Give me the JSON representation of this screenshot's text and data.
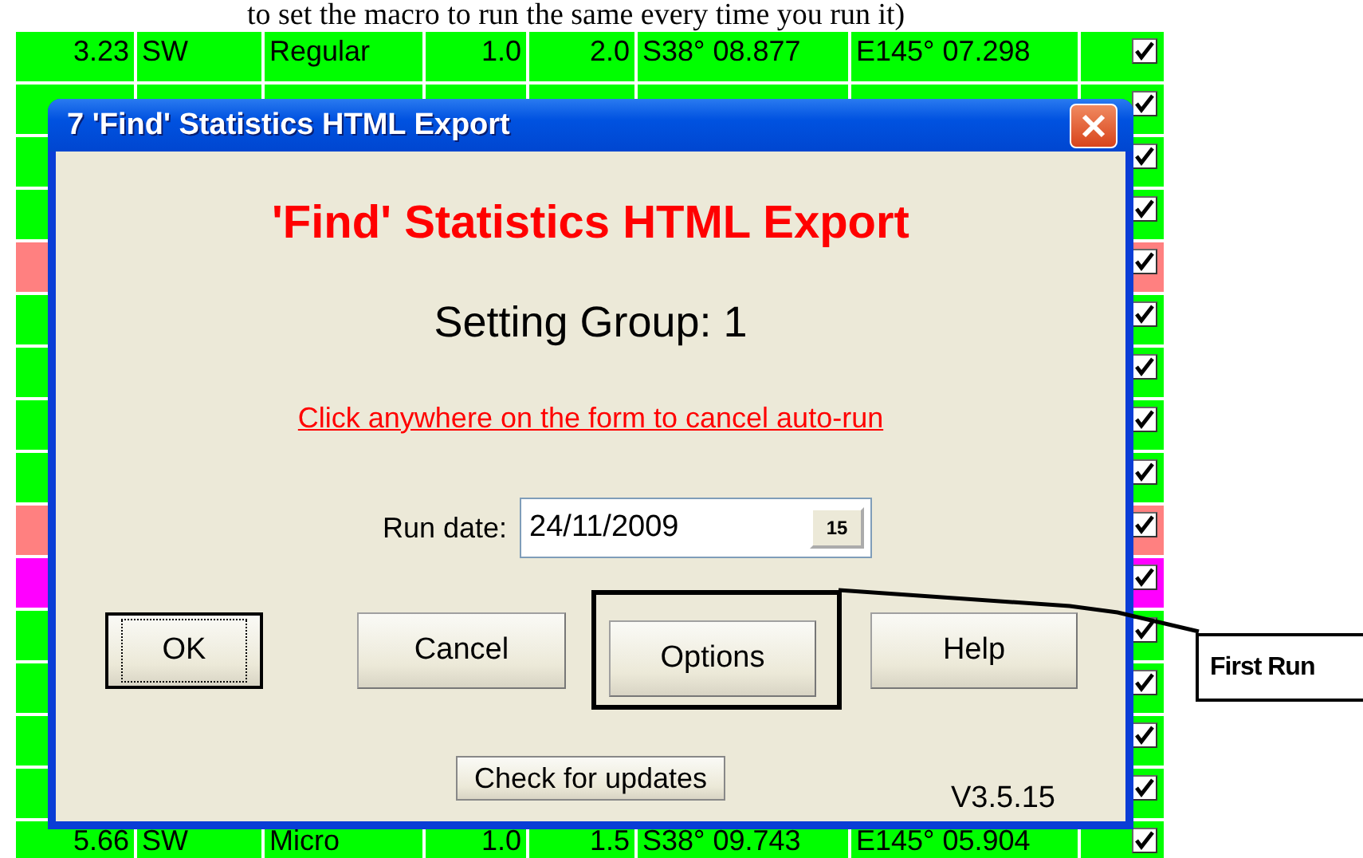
{
  "caption": "to set the macro to run the same every time you run it)",
  "table": {
    "rows": [
      {
        "cells": [
          "3.23",
          "SW",
          "Regular",
          "1.0",
          "2.0",
          "S38° 08.877",
          "E145° 07.298"
        ],
        "checked": true,
        "color": "#00ff00"
      },
      {
        "checked": true,
        "color": "#00ff00"
      },
      {
        "checked": true,
        "color": "#00ff00"
      },
      {
        "checked": true,
        "color": "#00ff00"
      },
      {
        "checked": true,
        "color": "#ff8080"
      },
      {
        "checked": true,
        "color": "#00ff00"
      },
      {
        "checked": true,
        "color": "#00ff00"
      },
      {
        "checked": true,
        "color": "#00ff00"
      },
      {
        "checked": true,
        "color": "#00ff00"
      },
      {
        "checked": true,
        "color": "#ff8080"
      },
      {
        "checked": true,
        "color": "#ff00ff"
      },
      {
        "checked": true,
        "color": "#00ff00"
      },
      {
        "checked": true,
        "color": "#00ff00"
      },
      {
        "checked": true,
        "color": "#00ff00"
      },
      {
        "checked": true,
        "color": "#00ff00"
      },
      {
        "cells": [
          "5.66",
          "SW",
          "Micro",
          "1.0",
          "1.5",
          "S38° 09.743",
          "E145° 05.904"
        ],
        "checked": true,
        "color": "#00ff00"
      }
    ]
  },
  "dialog": {
    "title": "7 'Find' Statistics HTML Export",
    "heading": "'Find' Statistics HTML Export",
    "setting_group": "Setting Group: 1",
    "cancel_link": "Click anywhere on the form to cancel auto-run",
    "run_date": {
      "label": "Run date:",
      "value": "24/11/2009",
      "calendar": "15"
    },
    "buttons": [
      {
        "label": "OK",
        "default": true,
        "highlighted": false
      },
      {
        "label": "Cancel",
        "default": false,
        "highlighted": false
      },
      {
        "label": "Options",
        "default": false,
        "highlighted": true
      },
      {
        "label": "Help",
        "default": false,
        "highlighted": false
      }
    ],
    "update_button": "Check for updates",
    "version": "V3.5.15"
  },
  "callout": {
    "label": "First Run"
  }
}
